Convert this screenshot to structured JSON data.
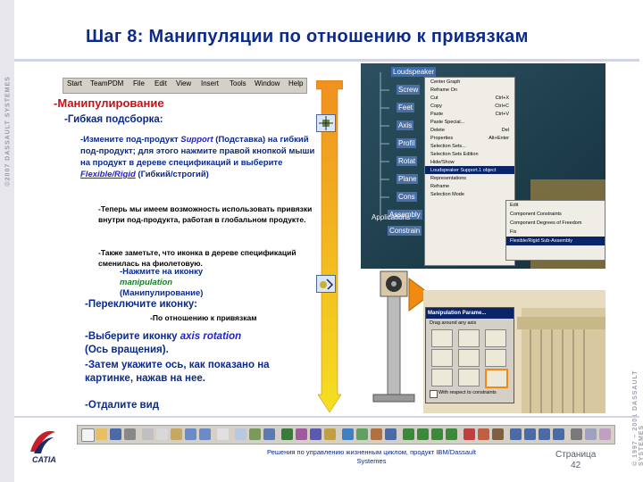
{
  "slide": {
    "title": "Шаг 8: Манипуляции по отношению к привязкам",
    "copyright_left": "©2007 DASSAULT SYSTEMES",
    "copyright_right": "© 1997 – 2001 DASSAULT SYSTEMES"
  },
  "menubar": {
    "items": [
      "Start",
      "TeamPDM",
      "File",
      "Edit",
      "View",
      "Insert",
      "Tools",
      "Window",
      "Help"
    ]
  },
  "content": {
    "heading": "-Манипулирование",
    "subheading": "-Гибкая подсборка:",
    "p1_a": "-Измените под-продукт ",
    "p1_support": "Support",
    "p1_b": " (Подставка) на гибкий под-продукт; для этого нажмите правой кнопкой мыши на продукт в дереве спецификаций и выберите ",
    "p1_flexible": "Flexible/Rigid",
    "p1_c": " (Гибкий/строгий)",
    "p2": "-Теперь мы имеем возможность использовать привязки внутри под-продукта, работая в глобальном продукте.",
    "p3": "-Также заметьте, что иконка в дереве спецификаций сменилась на фиолетовую.",
    "p4_a": "-Нажмите на иконку",
    "p4_manip": "manipulation",
    "p4_b": "(Манипулирование)",
    "p5": "-Переключите иконку:",
    "p6": "-По отношению к привязкам",
    "p7_a": "-Выберите иконку ",
    "p7_axis": "axis rotation",
    "p7_b": "(Ось вращения).",
    "p8": "-Затем укажите ось, как показано на картинке, нажав на нее.",
    "p9": "-Отдалите вид"
  },
  "tree": {
    "items": [
      "Loudspeaker",
      "Screw",
      "Feet",
      "Axis",
      "Profil",
      "Rotat",
      "Plane",
      "Cons",
      "Assembly",
      "Constrain",
      "Applications"
    ]
  },
  "context_menu": {
    "items": [
      "Center Graph",
      "Reframe On",
      "Cut",
      "Copy",
      "Paste",
      "Paste Special...",
      "Delete",
      "Properties",
      "Selection Sets...",
      "Selection Sets Edition",
      "Hide/Show",
      "Loudspeaker Support.1 object",
      "Representations",
      "Reframe",
      "Selection Mode"
    ],
    "shortcuts": [
      "",
      "",
      "Ctrl+X",
      "Ctrl+C",
      "Ctrl+V",
      "",
      "Del",
      "Alt+Enter",
      "",
      "",
      "",
      "",
      "",
      "",
      ""
    ]
  },
  "sub_menu": {
    "items": [
      "Edit",
      "Component Constraints",
      "Component Degrees of Freedom",
      "Fix",
      "Flexible/Rigid Sub-Assembly"
    ]
  },
  "dialog": {
    "title": "Manipulation Parame...",
    "drag_label": "Drag around any axis",
    "checkbox_label": "With respect to constraints"
  },
  "footer": {
    "line1": "Решения по управлению жизненным циклом, продукт IBM/Dassault",
    "line2": "Systemes",
    "page_label": "Страница",
    "page_number": "42",
    "logo_text": "CATIA"
  }
}
